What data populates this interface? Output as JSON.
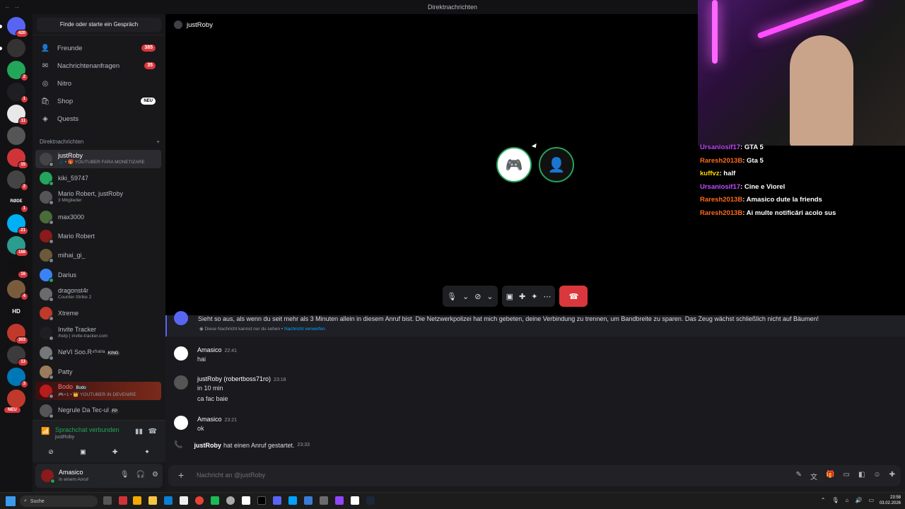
{
  "window": {
    "title": "Direktnachrichten"
  },
  "servers": [
    {
      "badge": "420"
    },
    {
      "badge": ""
    },
    {
      "badge": "2"
    },
    {
      "badge": "1"
    },
    {
      "badge": "11"
    },
    {
      "badge": ""
    },
    {
      "badge": "15"
    },
    {
      "badge": "2"
    },
    {
      "badge": "1"
    },
    {
      "badge": "21"
    },
    {
      "badge": "168"
    },
    {
      "badge": "16"
    },
    {
      "badge": "4"
    },
    {
      "badge": ""
    },
    {
      "badge": "303"
    },
    {
      "badge": "13"
    },
    {
      "badge": "3"
    },
    {
      "badge": ""
    }
  ],
  "server_labels": {
    "rode": "RØDE",
    "hd": "HD",
    "new": "NEU"
  },
  "sidebar": {
    "find_label": "Finde oder starte ein Gespräch",
    "nav": [
      {
        "label": "Freunde",
        "badge": "385",
        "icon": "friends-icon"
      },
      {
        "label": "Nachrichtenanfragen",
        "badge": "35",
        "icon": "mail-icon"
      },
      {
        "label": "Nitro",
        "badge": "",
        "icon": "nitro-icon"
      },
      {
        "label": "Shop",
        "badge": "NEU",
        "icon": "shop-icon"
      },
      {
        "label": "Quests",
        "badge": "",
        "icon": "quests-icon"
      }
    ],
    "dm_header": "Direktnachrichten",
    "dm_add": "+",
    "dms": [
      {
        "name": "justRoby",
        "sub": "🌑 • 🎁 YOUTUBER FARA MONETIZARE"
      },
      {
        "name": "kiki_59747",
        "sub": ""
      },
      {
        "name": "Mario Robert, justRoby",
        "sub": "3 Mitglieder"
      },
      {
        "name": "max3000",
        "sub": ""
      },
      {
        "name": "Mario Robert",
        "sub": ""
      },
      {
        "name": "mihai_gi_",
        "sub": ""
      },
      {
        "name": "Darius",
        "sub": ""
      },
      {
        "name": "dragonst4r",
        "sub": "Counter-Strike 2"
      },
      {
        "name": "Xtreme",
        "sub": ""
      },
      {
        "name": "Invite Tracker",
        "sub": "/help | invite-tracker.com"
      },
      {
        "name": "NøVI Soo.R⁴ᶠʳᵃᵗⁱᵃ",
        "sub": "",
        "tag": "KING"
      },
      {
        "name": "Patty",
        "sub": ""
      },
      {
        "name": "Bodo",
        "sub": "🎮+1 • 👑 YOUTUBER IN DEVENIRE",
        "tag": "Bodo"
      },
      {
        "name": "Negrule Da Tec-ul",
        "sub": "",
        "tag": "FP"
      }
    ],
    "voice": {
      "status": "Sprachchat verbunden",
      "user": "justRoby"
    },
    "user": {
      "name": "Amasico",
      "status": "In einem Anruf"
    }
  },
  "call": {
    "header_name": "justRoby"
  },
  "messages": {
    "system_text": "Sieht so aus, als wenn du seit mehr als 3 Minuten allein in diesem Anruf bist. Die Netzwerkpolizei hat mich gebeten, deine Verbindung zu trennen, um Bandbreite zu sparen. Das Zeug wächst schließlich nicht auf Bäumen!",
    "system_note": "Diese Nachricht kannst nur du sehen •",
    "system_link": "Nachricht verwerfen",
    "items": [
      {
        "author": "Amasico",
        "time": "22:41",
        "lines": [
          "hai"
        ]
      },
      {
        "author": "justRoby (robertboss71ro)",
        "time": "23:18",
        "lines": [
          "in 10 min",
          "ca fac baie"
        ]
      },
      {
        "author": "Amasico",
        "time": "23:21",
        "lines": [
          "ok"
        ]
      }
    ],
    "call_event": {
      "author": "justRoby",
      "text": "hat einen Anruf gestartet.",
      "time": "23:33"
    }
  },
  "composer": {
    "placeholder": "Nachricht an @justRoby"
  },
  "stream_chat": [
    {
      "user": "Ursaniosif17",
      "msg": "GTA 5",
      "color": "u4"
    },
    {
      "user": "Raresh2013B",
      "msg": "Gta 5",
      "color": "u1"
    },
    {
      "user": "kuffvz",
      "msg": "half",
      "color": "u3"
    },
    {
      "user": "Ursaniosif17",
      "msg": "Cine e Viorel",
      "color": "u4"
    },
    {
      "user": "Raresh2013B",
      "msg": "Amasico dute la friends",
      "color": "u1"
    },
    {
      "user": "Raresh2013B",
      "msg": "Ai multe notificări acolo sus",
      "color": "u1"
    }
  ],
  "taskbar": {
    "search": "Suche",
    "time": "23:58",
    "date": "03.02.2026"
  }
}
